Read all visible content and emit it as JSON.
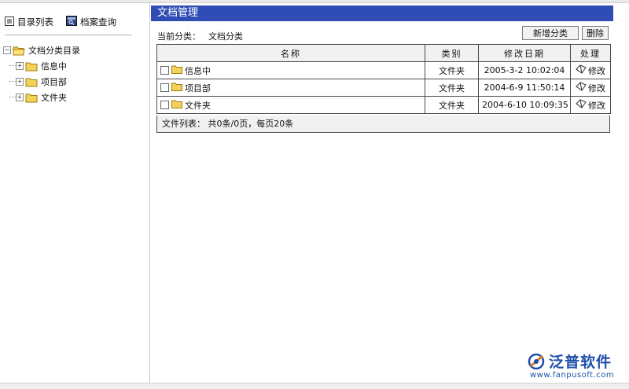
{
  "sidebar": {
    "tabs": [
      {
        "label": "目录列表",
        "icon": "directory-list-icon"
      },
      {
        "label": "档案查询",
        "icon": "archive-search-icon"
      }
    ],
    "tree": {
      "root": {
        "label": "文档分类目录",
        "toggle": "⊟"
      },
      "children": [
        {
          "label": "信息中",
          "toggle": "⊞"
        },
        {
          "label": "项目部",
          "toggle": "⊞"
        },
        {
          "label": "文件夹",
          "toggle": "⊞"
        }
      ]
    }
  },
  "main": {
    "title": "文档管理",
    "breadcrumb": {
      "label": "当前分类：",
      "value": "文档分类"
    },
    "buttons": {
      "new_category": "新增分类",
      "delete": "删除"
    },
    "table": {
      "headers": [
        "名称",
        "类别",
        "修改日期",
        "处理"
      ],
      "rows": [
        {
          "name": "信息中",
          "type": "文件夹",
          "date": "2005-3-2 10:02:04",
          "action": "修改"
        },
        {
          "name": "项目部",
          "type": "文件夹",
          "date": "2004-6-9 11:50:14",
          "action": "修改"
        },
        {
          "name": "文件夹",
          "type": "文件夹",
          "date": "2004-6-10 10:09:35",
          "action": "修改"
        }
      ],
      "footer": "文件列表： 共0条/0页，每页20条"
    }
  },
  "watermark": {
    "brand": "泛普软件",
    "url": "www.fanpusoft.com"
  },
  "colors": {
    "title_bar": "#2f4db4",
    "folder": "#f2d25a",
    "brand": "#1e4fa8"
  }
}
